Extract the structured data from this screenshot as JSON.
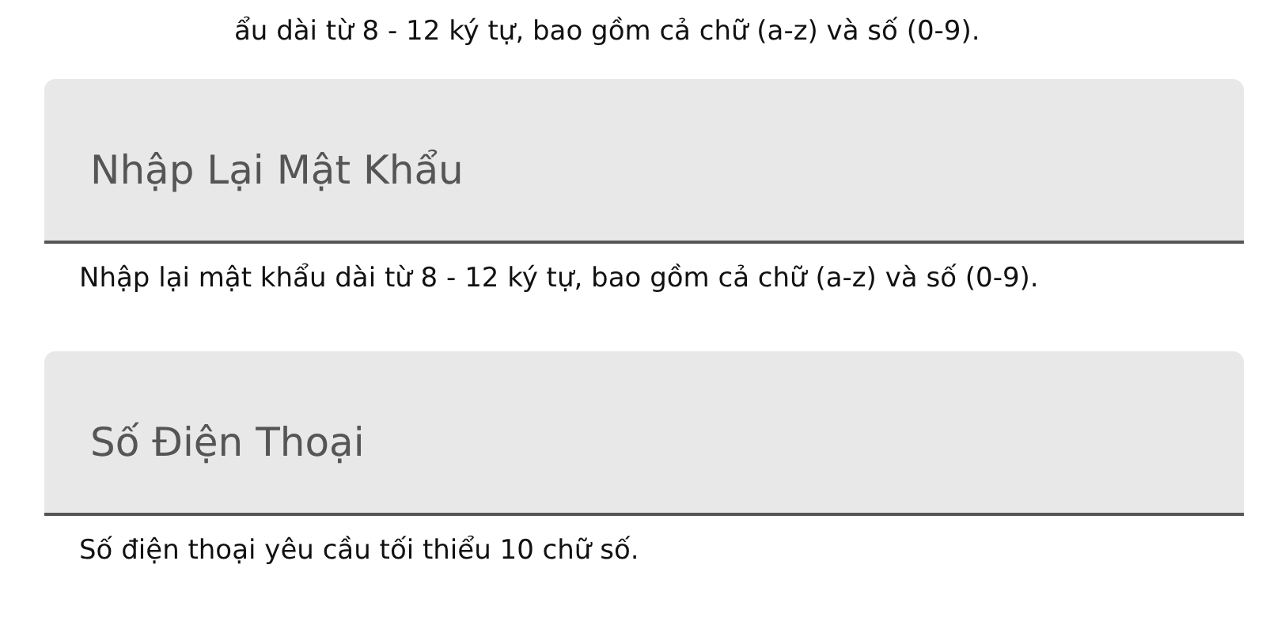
{
  "top_hint": "ẩu dài từ 8 - 12 ký tự, bao gồm cả chữ (a-z) và số (0-9).",
  "fields": [
    {
      "placeholder": "Nhập Lại Mật Khẩu",
      "hint": "Nhập lại mật khẩu dài từ 8 - 12 ký tự, bao gồm cả chữ (a-z) và số (0-9)."
    },
    {
      "placeholder": "Số Điện Thoại",
      "hint": "Số điện thoại yêu cầu tối thiểu 10 chữ số."
    }
  ]
}
